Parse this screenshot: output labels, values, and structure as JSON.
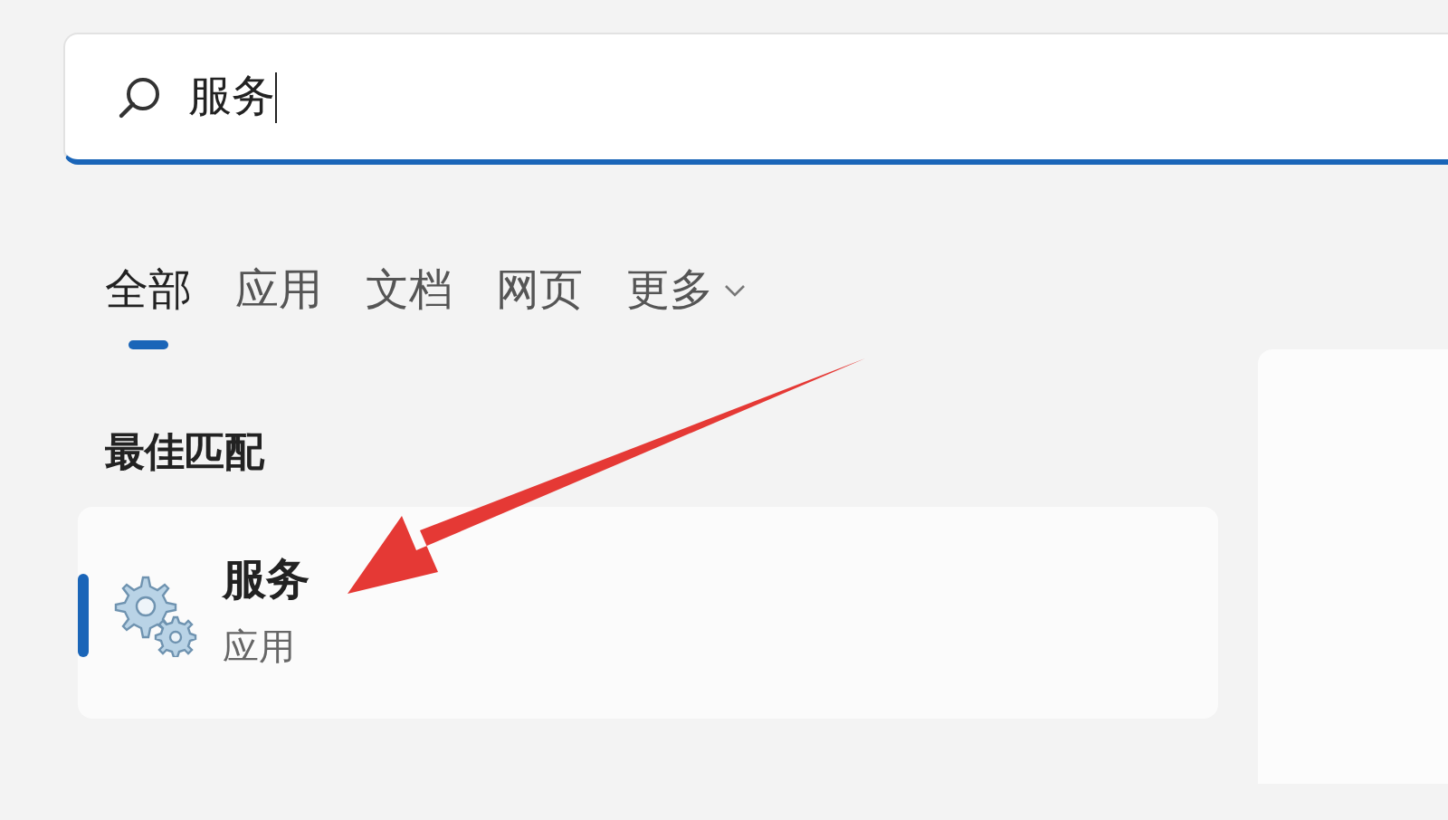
{
  "search": {
    "value": "服务"
  },
  "tabs": [
    {
      "label": "全部",
      "selected": true,
      "kind": "tab"
    },
    {
      "label": "应用",
      "selected": false,
      "kind": "tab"
    },
    {
      "label": "文档",
      "selected": false,
      "kind": "tab"
    },
    {
      "label": "网页",
      "selected": false,
      "kind": "tab"
    },
    {
      "label": "更多",
      "selected": false,
      "kind": "dropdown"
    }
  ],
  "best_match": {
    "heading": "最佳匹配",
    "results": [
      {
        "title": "服务",
        "subtitle": "应用",
        "selected": true
      }
    ]
  }
}
